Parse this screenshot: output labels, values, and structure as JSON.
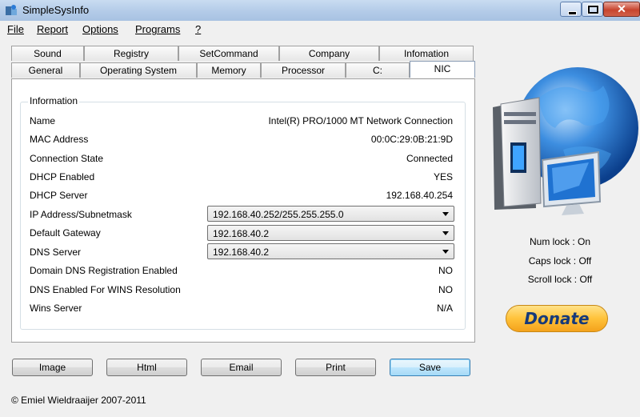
{
  "window": {
    "title": "SimpleSysInfo"
  },
  "menu": [
    "File",
    "Report",
    "Options",
    "Programs",
    "?"
  ],
  "tabs_row1": [
    "Sound",
    "Registry",
    "SetCommand",
    "Company",
    "Infomation"
  ],
  "tabs_row2": [
    "General",
    "Operating System",
    "Memory",
    "Processor",
    "C:",
    "NIC"
  ],
  "active_tab": "NIC",
  "group": {
    "title": "Information",
    "rows": [
      {
        "label": "Name",
        "value": "Intel(R) PRO/1000 MT Network Connection"
      },
      {
        "label": "MAC Address",
        "value": "00:0C:29:0B:21:9D"
      },
      {
        "label": "Connection State",
        "value": "Connected"
      },
      {
        "label": "DHCP Enabled",
        "value": "YES"
      },
      {
        "label": "DHCP Server",
        "value": "192.168.40.254"
      },
      {
        "label": "IP Address/Subnetmask",
        "combo": "192.168.40.252/255.255.255.0"
      },
      {
        "label": "Default Gateway",
        "combo": "192.168.40.2"
      },
      {
        "label": "DNS Server",
        "combo": "192.168.40.2"
      },
      {
        "label": "Domain DNS Registration Enabled",
        "value": "NO"
      },
      {
        "label": "DNS Enabled For WINS Resolution",
        "value": "NO"
      },
      {
        "label": "Wins Server",
        "value": "N/A"
      }
    ]
  },
  "buttons": [
    "Image",
    "Html",
    "Email",
    "Print",
    "Save"
  ],
  "locks": {
    "num": "Num lock : On",
    "caps": "Caps lock : Off",
    "scroll": "Scroll lock : Off"
  },
  "donate_label": "Donate",
  "copyright": "© Emiel Wieldraaijer 2007-2011",
  "colors": {
    "titlebar": "#b9cfea",
    "donate": "#ffc23a",
    "donate_text": "#163a7a",
    "close": "#c8452f"
  }
}
